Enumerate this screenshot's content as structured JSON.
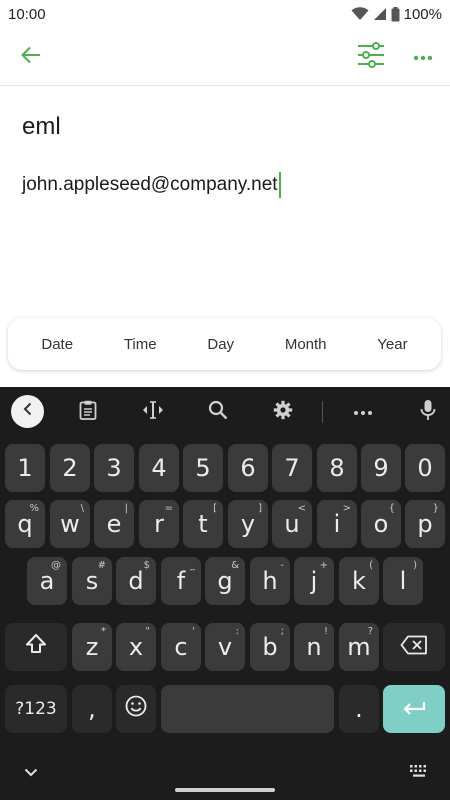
{
  "status": {
    "time": "10:00",
    "battery": "100%"
  },
  "note": {
    "title": "eml",
    "body": "john.appleseed@company.net"
  },
  "suggestions": [
    "Date",
    "Time",
    "Day",
    "Month",
    "Year"
  ],
  "toolbar_icons": [
    "collapse-icon",
    "clipboard-icon",
    "cursor-move-icon",
    "search-icon",
    "settings-gear-icon",
    "more-dots-icon",
    "microphone-icon"
  ],
  "keyboard": {
    "numbers": [
      "1",
      "2",
      "3",
      "4",
      "5",
      "6",
      "7",
      "8",
      "9",
      "0"
    ],
    "row1": [
      {
        "k": "q",
        "a": "%"
      },
      {
        "k": "w",
        "a": "\\"
      },
      {
        "k": "e",
        "a": "|"
      },
      {
        "k": "r",
        "a": "="
      },
      {
        "k": "t",
        "a": "["
      },
      {
        "k": "y",
        "a": "]"
      },
      {
        "k": "u",
        "a": "<"
      },
      {
        "k": "i",
        "a": ">"
      },
      {
        "k": "o",
        "a": "{"
      },
      {
        "k": "p",
        "a": "}"
      }
    ],
    "row2": [
      {
        "k": "a",
        "a": "@"
      },
      {
        "k": "s",
        "a": "#"
      },
      {
        "k": "d",
        "a": "$"
      },
      {
        "k": "f",
        "a": "_"
      },
      {
        "k": "g",
        "a": "&"
      },
      {
        "k": "h",
        "a": "-"
      },
      {
        "k": "j",
        "a": "+"
      },
      {
        "k": "k",
        "a": "("
      },
      {
        "k": "l",
        "a": ")"
      }
    ],
    "row3": [
      {
        "k": "z",
        "a": "*"
      },
      {
        "k": "x",
        "a": "\""
      },
      {
        "k": "c",
        "a": "'"
      },
      {
        "k": "v",
        "a": ":"
      },
      {
        "k": "b",
        "a": ";"
      },
      {
        "k": "n",
        "a": "!"
      },
      {
        "k": "m",
        "a": "?"
      }
    ],
    "symbols_label": "?123",
    "comma": ",",
    "period": "."
  },
  "colors": {
    "accent": "#4caf50",
    "keyboard_bg": "#1c1c1c",
    "key": "#3b3b3b",
    "enter": "#7fcfc6"
  }
}
